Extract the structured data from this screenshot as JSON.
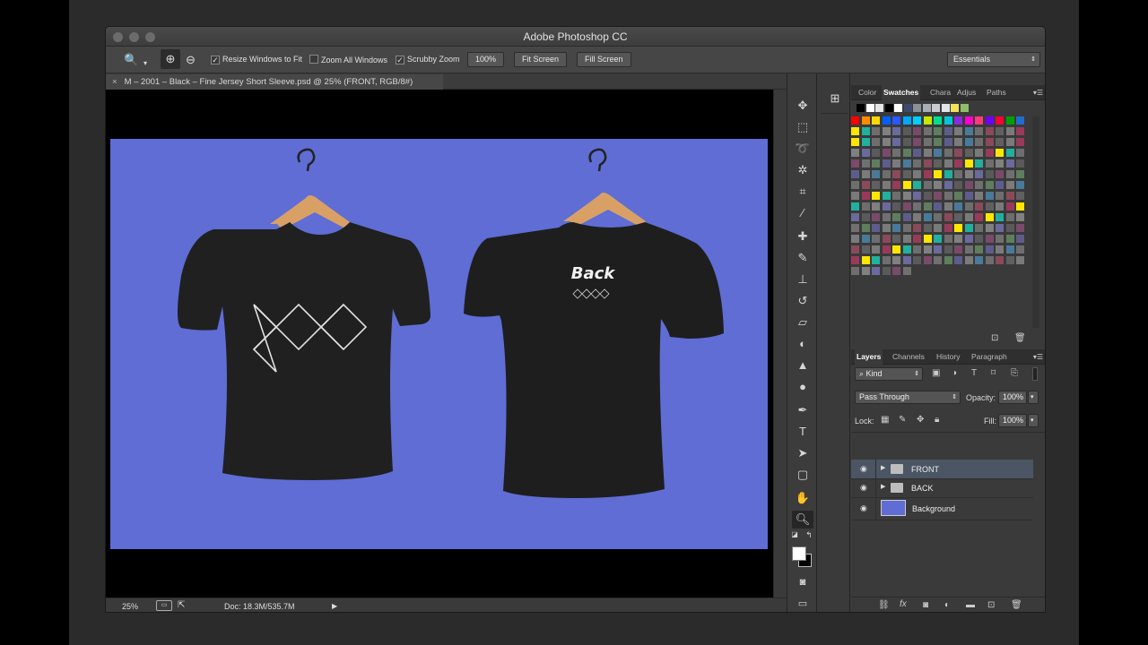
{
  "window": {
    "title": "Adobe Photoshop CC"
  },
  "options": {
    "resize_windows_label": "Resize Windows to Fit",
    "zoom_all_label": "Zoom All Windows",
    "scrubby_zoom_label": "Scrubby Zoom",
    "zoom_value": "100%",
    "fit_screen_label": "Fit Screen",
    "fill_screen_label": "Fill Screen",
    "workspace_value": "Essentials"
  },
  "document": {
    "tab_close": "×",
    "tab_title": "M – 2001 – Black – Fine Jersey Short Sleeve.psd @ 25% (FRONT, RGB/8#)",
    "back_label": "Back"
  },
  "status": {
    "zoom": "25%",
    "doc_size": "Doc: 18.3M/535.7M"
  },
  "swatches_panel": {
    "tabs": [
      "Color",
      "Swatches",
      "Chara",
      "Adjus",
      "Paths"
    ],
    "active_tab": "Swatches",
    "colors": {
      "top_row": [
        "#000000",
        "#ffffff",
        "#e6e6e6",
        "#000000",
        "#ffffff",
        "#3d4a6b",
        "#8a8f99",
        "#a8adb6",
        "#c8ccd3",
        "#e2e5ea",
        "#f1e25a",
        "#8fbf6a"
      ],
      "row1": [
        "#ff0000",
        "#ff8a00",
        "#ffd800",
        "#0060ff",
        "#2a57ff",
        "#00a8ff",
        "#00cfff",
        "#c8e600",
        "#00e08a",
        "#00c8d8",
        "#8a2be2",
        "#ff00d0",
        "#ff3c7a",
        "#6f00ff",
        "#ff0033",
        "#00a000",
        "#1f6dd0"
      ],
      "row2": [
        "#ffe600",
        "#21b0a0",
        "#6e6e6e",
        "#808080",
        "#6a6a9e",
        "#5a5a5a",
        "#7a4a6a",
        "#707070",
        "#5e7e5e",
        "#5d5d8d",
        "#7b7b7b",
        "#4a7a9a",
        "#6e6e6e",
        "#8a4a5a",
        "#606060",
        "#7a7a7a",
        "#9a3a5a"
      ]
    }
  },
  "layers_panel": {
    "tabs": [
      "Layers",
      "Channels",
      "History",
      "Paragraph"
    ],
    "active_tab": "Layers",
    "kind_filter": "Kind",
    "blend_mode": "Pass Through",
    "opacity_label": "Opacity:",
    "opacity_value": "100%",
    "lock_label": "Lock:",
    "fill_label": "Fill:",
    "fill_value": "100%",
    "layers": [
      {
        "name": "FRONT",
        "type": "group",
        "selected": true
      },
      {
        "name": "BACK",
        "type": "group",
        "selected": false
      },
      {
        "name": "Background",
        "type": "pixel",
        "thumb_color": "#5f6dd5",
        "selected": false
      }
    ]
  }
}
